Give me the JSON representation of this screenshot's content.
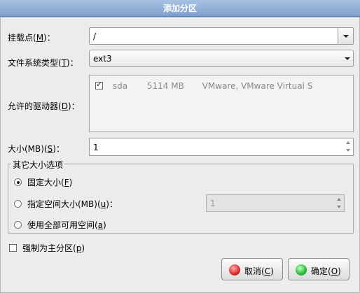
{
  "window": {
    "title": "添加分区"
  },
  "mount_point": {
    "label": "挂载点(",
    "mnemonic": "M",
    "label_end": ")：",
    "value": "/"
  },
  "fs_type": {
    "label": "文件系统类型(",
    "mnemonic": "T",
    "label_end": ")：",
    "value": "ext3"
  },
  "drives": {
    "label": "允许的驱动器(",
    "mnemonic": "D",
    "label_end": ")：",
    "rows": [
      {
        "name": "sda",
        "size": "5114 MB",
        "model": "VMware, VMware Virtual S",
        "checked": true
      }
    ]
  },
  "size": {
    "label": "大小(MB)(",
    "mnemonic": "S",
    "label_end": ")：",
    "value": "1"
  },
  "size_options": {
    "title": "其它大小选项",
    "fixed": {
      "label": "固定大小(",
      "mnemonic": "F",
      "label_end": ")"
    },
    "up_to": {
      "label": "指定空间大小(MB)(",
      "mnemonic": "u",
      "label_end": ")：",
      "value": "1"
    },
    "fill": {
      "label": "使用全部可用空间(",
      "mnemonic": "a",
      "label_end": ")"
    }
  },
  "primary": {
    "label": "强制为主分区(",
    "mnemonic": "p",
    "label_end": ")"
  },
  "buttons": {
    "cancel": {
      "label": "取消(",
      "mnemonic": "C",
      "label_end": ")"
    },
    "ok": {
      "label": "确定(",
      "mnemonic": "O",
      "label_end": ")"
    }
  },
  "colors": {
    "title_bar": "#8faad4",
    "cancel_icon": "#e23030",
    "ok_icon": "#2fc23a"
  }
}
